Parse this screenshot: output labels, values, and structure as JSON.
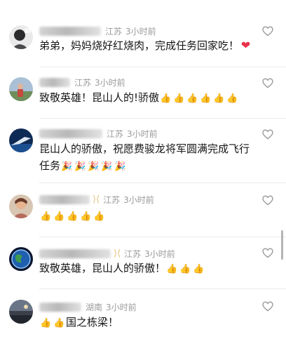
{
  "comments": [
    {
      "location": "江苏",
      "time": "3小时前",
      "text": "弟弟，妈妈烧好红烧肉，完成任务回家吃！",
      "emoji": [
        "red-heart"
      ]
    },
    {
      "location": "江苏",
      "time": "3小时前",
      "text": "致敬英雄！昆山人的!骄傲",
      "emoji": [
        "thumbs-up",
        "thumbs-up",
        "thumbs-up",
        "thumbs-up",
        "thumbs-up",
        "thumbs-up"
      ]
    },
    {
      "location": "江苏",
      "time": "3小时前",
      "text": "昆山人的骄傲，祝愿费骏龙将军圆满完成飞行任务",
      "emoji": [
        "party-popper",
        "party-popper",
        "party-popper",
        "party-popper",
        "party-popper"
      ]
    },
    {
      "location": "江苏",
      "time": "3小时前",
      "text": "",
      "emoji": [
        "thumbs-up",
        "thumbs-up",
        "thumbs-up",
        "thumbs-up",
        "thumbs-up"
      ]
    },
    {
      "location": "江苏",
      "time": "3小时前",
      "text": "致敬英雄，昆山人的骄傲！",
      "emoji": [
        "thumbs-up",
        "thumbs-up",
        "thumbs-up"
      ]
    },
    {
      "location": "湖南",
      "time": "3小时前",
      "text": "国之栋梁！",
      "emoji": [
        "thumbs-up",
        "thumbs-up"
      ]
    }
  ],
  "colors": {
    "meta_text": "#9a9a9a",
    "body_text": "#161616",
    "like_icon": "#9a9a9a",
    "badge": "#e7c079"
  }
}
